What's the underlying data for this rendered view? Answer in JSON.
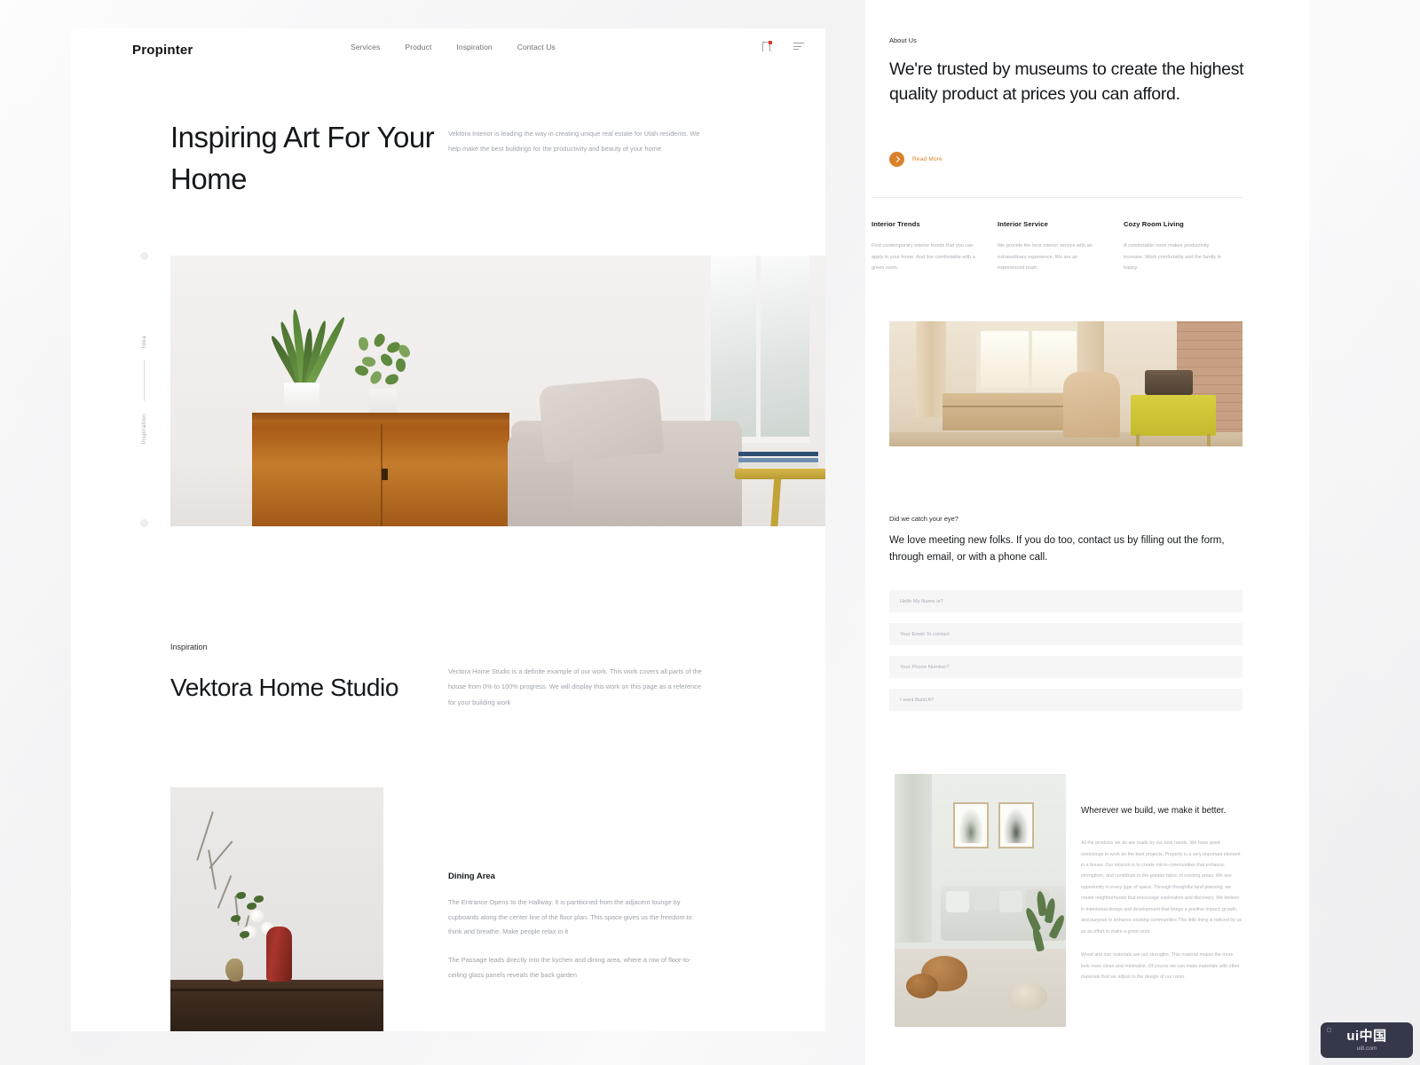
{
  "theme": {
    "accent": "#d9822b",
    "ink": "#15181b",
    "muted": "#9ea3a9",
    "panel_bg": "#ffffff",
    "page_bg": "#f2f2f3",
    "field_bg": "#f6f6f7",
    "notification_dot": "#e0382e"
  },
  "nav": {
    "brand": "Propinter",
    "links": [
      {
        "label": "Services"
      },
      {
        "label": "Product"
      },
      {
        "label": "Inspiration"
      },
      {
        "label": "Contact Us"
      }
    ],
    "icons": [
      {
        "name": "bookmark-icon",
        "badge": true
      },
      {
        "name": "hamburger-menu-icon",
        "badge": false
      }
    ]
  },
  "hero": {
    "title": "Inspiring Art For Your Home",
    "body": "Vektora Interior is leading the way in creating unique real estate for Utah residents. We help make the best buildings for the productivity and beauty of your home",
    "rail": {
      "top_label": "Idea",
      "bottom_label": "Inspiration"
    }
  },
  "inspiration": {
    "eyebrow": "Inspiration",
    "title": "Vektora Home Studio",
    "body": "Vectora Home Studio is a definite example of our work. This work covers all parts of the house from 0% to 100% progress. We will display this work on this page as a reference for your building work"
  },
  "dining": {
    "title": "Dining Area",
    "paragraph1": "The Entrance Opens to the Hallway. It is partitioned from the adjacent lounge by cupboards along the center line of the floor plan. This space gives us the freedom to think and breathe. Make people relax in it",
    "paragraph2": "The Passage leads directly into the kychen and dining area, where a row of floor-to-ceiling glass panels reveals the back garden"
  },
  "about": {
    "eyebrow": "About Us",
    "headline": "We're trusted by museums to create the highest quality product at prices you can afford.",
    "read_more": "Read More"
  },
  "features": [
    {
      "title": "Interior Trends",
      "body": "Find contemporary interior trends that you can apply in your home. And live comfortable with a green room."
    },
    {
      "title": "Interior Service",
      "body": "We provide the best interior service with an extraordinary experience. We are an experienced team."
    },
    {
      "title": "Cozy Room Living",
      "body": "A comfortable room makes productivity increase. Work comfortably and the family is happy."
    }
  ],
  "contact": {
    "eyebrow": "Did we catch your eye?",
    "text": "We love meeting new folks. If you do too, contact us by filling out the form, through email, or with a phone call.",
    "fields": [
      {
        "name": "name",
        "placeholder": "Hello My Name is?",
        "value": ""
      },
      {
        "name": "email",
        "placeholder": "Your Email To contact",
        "value": ""
      },
      {
        "name": "phone",
        "placeholder": "Your Phone Number?",
        "value": ""
      },
      {
        "name": "project",
        "placeholder": "I want Build A?",
        "value": ""
      }
    ]
  },
  "build": {
    "title": "Wherever we build, we make it better.",
    "paragraph1": "All the products we do are made by our best hands. We have good workshops to work on the best projects. Property is a very important element in a house. Our mission is to create micro-communities that enhance, strengthen, and contribute to the greater fabric of existing areas. We see opportunity in every type of space. Through thoughtful land planning, we create neighborhoods that encourage exploration and discovery. We believe in intentional design and development that brings a positive impact, growth, and purpose to enhance existing communities.This little thing is noticed by us as an effort to make a great work.",
    "paragraph2": "Wood and iron materials are our strengths. This material makes the more look more clean and minimalist. Of course we can make materials with other materials that we adjust to the design of our room."
  },
  "watermark": {
    "main": "ui中国",
    "sub": "ui8.com"
  }
}
